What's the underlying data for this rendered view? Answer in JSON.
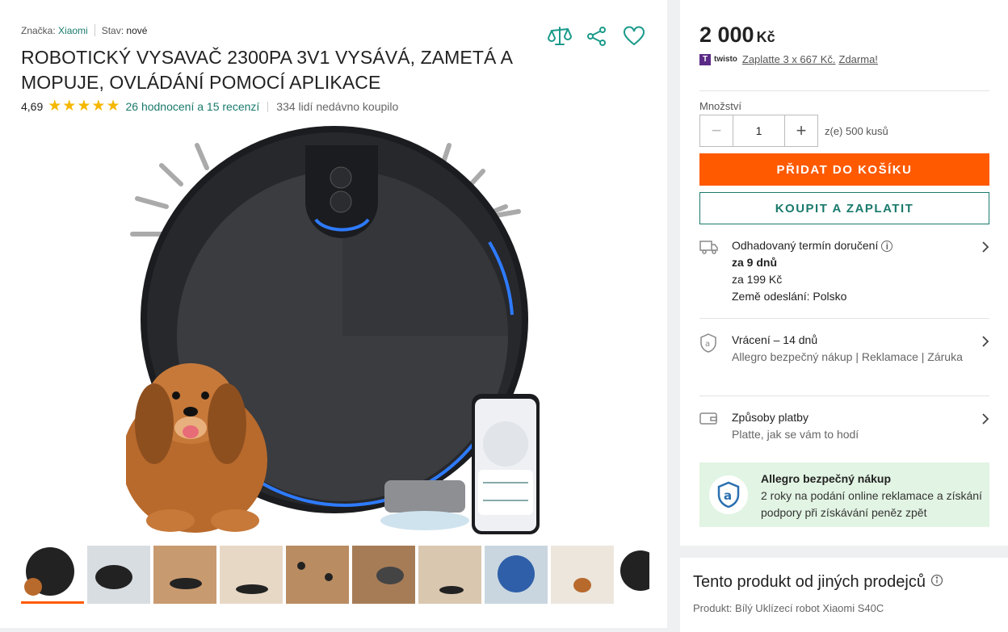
{
  "product": {
    "brand_label": "Značka:",
    "brand_value": "Xiaomi",
    "state_label": "Stav:",
    "state_value": "nové",
    "title": "ROBOTICKÝ VYSAVAČ 2300PA 3V1 VYSÁVÁ, ZAMETÁ A MOPUJE, OVLÁDÁNÍ POMOCÍ APLIKACE",
    "rating_value": "4,69",
    "rating_stars": 5,
    "reviews_link": "26 hodnocení a 15 recenzí",
    "recent_buyers": "334 lidí nedávno koupilo"
  },
  "icons": {
    "compare": "scales-icon",
    "share": "share-icon",
    "favorite": "heart-icon"
  },
  "purchase": {
    "price": "2 000",
    "currency": "Kč",
    "twisto_brand": "twisto",
    "twisto_link": "Zaplatte 3 x 667 Kč.",
    "twisto_free": "Zdarma!",
    "quantity_label": "Množství",
    "quantity_value": "1",
    "availability": "z(e) 500 kusů",
    "add_to_cart": "PŘIDAT DO KOŠÍKU",
    "buy_now": "KOUPIT A ZAPLATIT"
  },
  "delivery": {
    "label": "Odhadovaný termín doručení",
    "eta": "za 9 dnů",
    "price": "za 199 Kč",
    "origin": "Země odeslání: Polsko"
  },
  "returns": {
    "label": "Vrácení – 14 dnů",
    "sub": "Allegro bezpečný nákup | Reklamace | Záruka"
  },
  "payment": {
    "label": "Způsoby platby",
    "sub": "Platte, jak se vám to hodí"
  },
  "safe_purchase": {
    "title": "Allegro bezpečný nákup",
    "text": "2 roky na podání online reklamace a získání podpory při získávání peněz zpět"
  },
  "other_sellers": {
    "title": "Tento produkt od jiných prodejců",
    "product": "Produkt: Bílý Uklízecí robot Xiaomi S40C"
  },
  "colors": {
    "accent_orange": "#ff5a00",
    "accent_teal": "#1a7a6c",
    "safe_green_bg": "#e2f4e3"
  }
}
